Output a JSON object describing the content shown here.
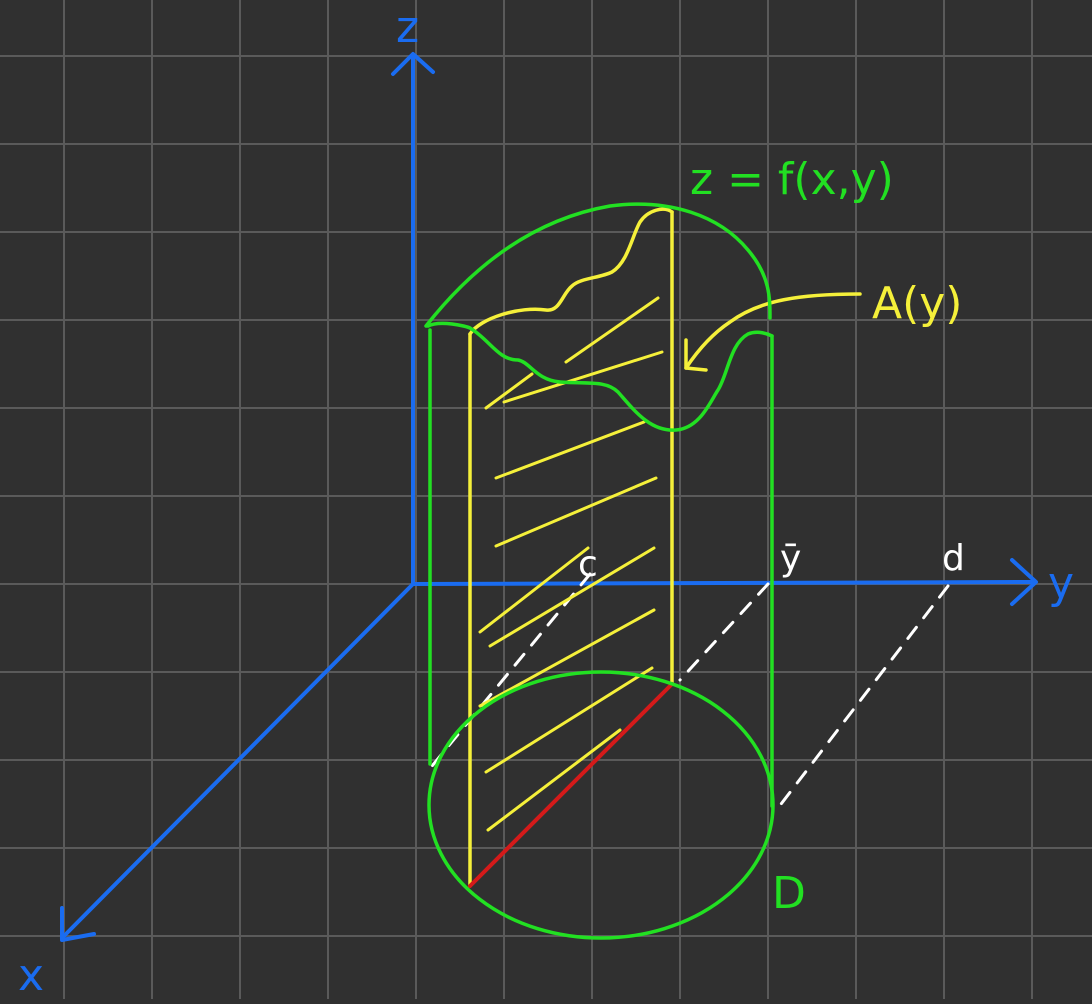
{
  "colors": {
    "background": "#303030",
    "grid": "#5a5a5a",
    "axis": "#1a6cf0",
    "cylinder": "#22e022",
    "slice": "#f5f03a",
    "white_dashes": "#ffffff",
    "red_segment": "#d41a1a"
  },
  "labels": {
    "axis_z": "z",
    "axis_y": "y",
    "axis_x": "x",
    "surface": "z = f(x,y)",
    "cross_section": "A(y)",
    "c": "c",
    "d": "d",
    "ybar": "ȳ",
    "region": "D"
  }
}
